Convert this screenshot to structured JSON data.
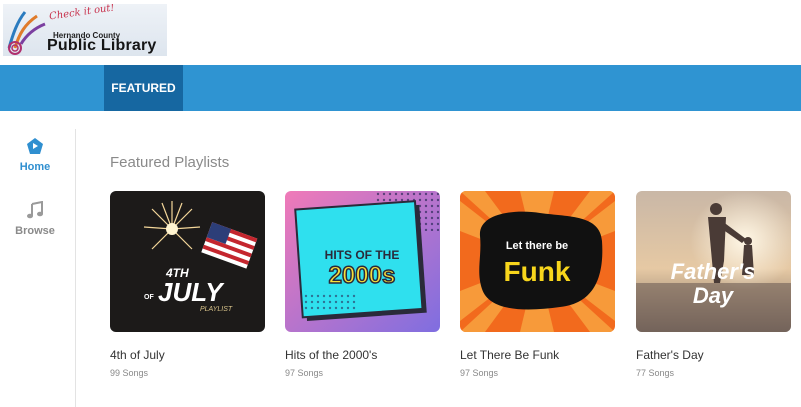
{
  "logo": {
    "tagline": "Check it out!",
    "county": "Hernando County",
    "name": "Public Library"
  },
  "nav": {
    "tabs": [
      {
        "label": "FEATURED",
        "active": true
      }
    ]
  },
  "sidebar": {
    "items": [
      {
        "label": "Home",
        "icon": "home-icon",
        "active": true
      },
      {
        "label": "Browse",
        "icon": "music-note-icon",
        "active": false
      }
    ]
  },
  "main": {
    "section_title": "Featured Playlists",
    "playlists": [
      {
        "title": "4th of July",
        "count": "99 Songs",
        "art": {
          "line1": "4TH",
          "line2": "JULY",
          "of": "OF",
          "sub": "PLAYLIST"
        }
      },
      {
        "title": "Hits of the 2000's",
        "count": "97 Songs",
        "art": {
          "line1": "HITS OF THE",
          "line2": "2000s"
        }
      },
      {
        "title": "Let There Be Funk",
        "count": "97 Songs",
        "art": {
          "line1": "Let there be",
          "line2": "Funk"
        }
      },
      {
        "title": "Father's Day",
        "count": "77 Songs",
        "art": {
          "line1": "Father's",
          "line2": "Day"
        }
      }
    ]
  },
  "colors": {
    "nav": "#2f94d2",
    "nav_active": "#1667a1",
    "accent": "#2f8fd0"
  }
}
